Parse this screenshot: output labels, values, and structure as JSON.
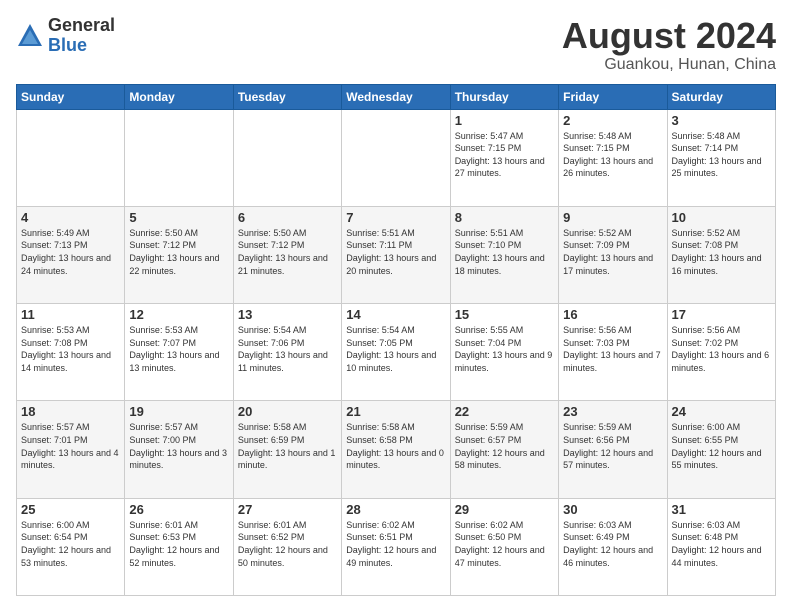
{
  "logo": {
    "general": "General",
    "blue": "Blue"
  },
  "header": {
    "title": "August 2024",
    "subtitle": "Guankou, Hunan, China"
  },
  "days_of_week": [
    "Sunday",
    "Monday",
    "Tuesday",
    "Wednesday",
    "Thursday",
    "Friday",
    "Saturday"
  ],
  "weeks": [
    [
      {
        "day": "",
        "info": ""
      },
      {
        "day": "",
        "info": ""
      },
      {
        "day": "",
        "info": ""
      },
      {
        "day": "",
        "info": ""
      },
      {
        "day": "1",
        "info": "Sunrise: 5:47 AM\nSunset: 7:15 PM\nDaylight: 13 hours\nand 27 minutes."
      },
      {
        "day": "2",
        "info": "Sunrise: 5:48 AM\nSunset: 7:15 PM\nDaylight: 13 hours\nand 26 minutes."
      },
      {
        "day": "3",
        "info": "Sunrise: 5:48 AM\nSunset: 7:14 PM\nDaylight: 13 hours\nand 25 minutes."
      }
    ],
    [
      {
        "day": "4",
        "info": "Sunrise: 5:49 AM\nSunset: 7:13 PM\nDaylight: 13 hours\nand 24 minutes."
      },
      {
        "day": "5",
        "info": "Sunrise: 5:50 AM\nSunset: 7:12 PM\nDaylight: 13 hours\nand 22 minutes."
      },
      {
        "day": "6",
        "info": "Sunrise: 5:50 AM\nSunset: 7:12 PM\nDaylight: 13 hours\nand 21 minutes."
      },
      {
        "day": "7",
        "info": "Sunrise: 5:51 AM\nSunset: 7:11 PM\nDaylight: 13 hours\nand 20 minutes."
      },
      {
        "day": "8",
        "info": "Sunrise: 5:51 AM\nSunset: 7:10 PM\nDaylight: 13 hours\nand 18 minutes."
      },
      {
        "day": "9",
        "info": "Sunrise: 5:52 AM\nSunset: 7:09 PM\nDaylight: 13 hours\nand 17 minutes."
      },
      {
        "day": "10",
        "info": "Sunrise: 5:52 AM\nSunset: 7:08 PM\nDaylight: 13 hours\nand 16 minutes."
      }
    ],
    [
      {
        "day": "11",
        "info": "Sunrise: 5:53 AM\nSunset: 7:08 PM\nDaylight: 13 hours\nand 14 minutes."
      },
      {
        "day": "12",
        "info": "Sunrise: 5:53 AM\nSunset: 7:07 PM\nDaylight: 13 hours\nand 13 minutes."
      },
      {
        "day": "13",
        "info": "Sunrise: 5:54 AM\nSunset: 7:06 PM\nDaylight: 13 hours\nand 11 minutes."
      },
      {
        "day": "14",
        "info": "Sunrise: 5:54 AM\nSunset: 7:05 PM\nDaylight: 13 hours\nand 10 minutes."
      },
      {
        "day": "15",
        "info": "Sunrise: 5:55 AM\nSunset: 7:04 PM\nDaylight: 13 hours\nand 9 minutes."
      },
      {
        "day": "16",
        "info": "Sunrise: 5:56 AM\nSunset: 7:03 PM\nDaylight: 13 hours\nand 7 minutes."
      },
      {
        "day": "17",
        "info": "Sunrise: 5:56 AM\nSunset: 7:02 PM\nDaylight: 13 hours\nand 6 minutes."
      }
    ],
    [
      {
        "day": "18",
        "info": "Sunrise: 5:57 AM\nSunset: 7:01 PM\nDaylight: 13 hours\nand 4 minutes."
      },
      {
        "day": "19",
        "info": "Sunrise: 5:57 AM\nSunset: 7:00 PM\nDaylight: 13 hours\nand 3 minutes."
      },
      {
        "day": "20",
        "info": "Sunrise: 5:58 AM\nSunset: 6:59 PM\nDaylight: 13 hours\nand 1 minute."
      },
      {
        "day": "21",
        "info": "Sunrise: 5:58 AM\nSunset: 6:58 PM\nDaylight: 13 hours\nand 0 minutes."
      },
      {
        "day": "22",
        "info": "Sunrise: 5:59 AM\nSunset: 6:57 PM\nDaylight: 12 hours\nand 58 minutes."
      },
      {
        "day": "23",
        "info": "Sunrise: 5:59 AM\nSunset: 6:56 PM\nDaylight: 12 hours\nand 57 minutes."
      },
      {
        "day": "24",
        "info": "Sunrise: 6:00 AM\nSunset: 6:55 PM\nDaylight: 12 hours\nand 55 minutes."
      }
    ],
    [
      {
        "day": "25",
        "info": "Sunrise: 6:00 AM\nSunset: 6:54 PM\nDaylight: 12 hours\nand 53 minutes."
      },
      {
        "day": "26",
        "info": "Sunrise: 6:01 AM\nSunset: 6:53 PM\nDaylight: 12 hours\nand 52 minutes."
      },
      {
        "day": "27",
        "info": "Sunrise: 6:01 AM\nSunset: 6:52 PM\nDaylight: 12 hours\nand 50 minutes."
      },
      {
        "day": "28",
        "info": "Sunrise: 6:02 AM\nSunset: 6:51 PM\nDaylight: 12 hours\nand 49 minutes."
      },
      {
        "day": "29",
        "info": "Sunrise: 6:02 AM\nSunset: 6:50 PM\nDaylight: 12 hours\nand 47 minutes."
      },
      {
        "day": "30",
        "info": "Sunrise: 6:03 AM\nSunset: 6:49 PM\nDaylight: 12 hours\nand 46 minutes."
      },
      {
        "day": "31",
        "info": "Sunrise: 6:03 AM\nSunset: 6:48 PM\nDaylight: 12 hours\nand 44 minutes."
      }
    ]
  ]
}
